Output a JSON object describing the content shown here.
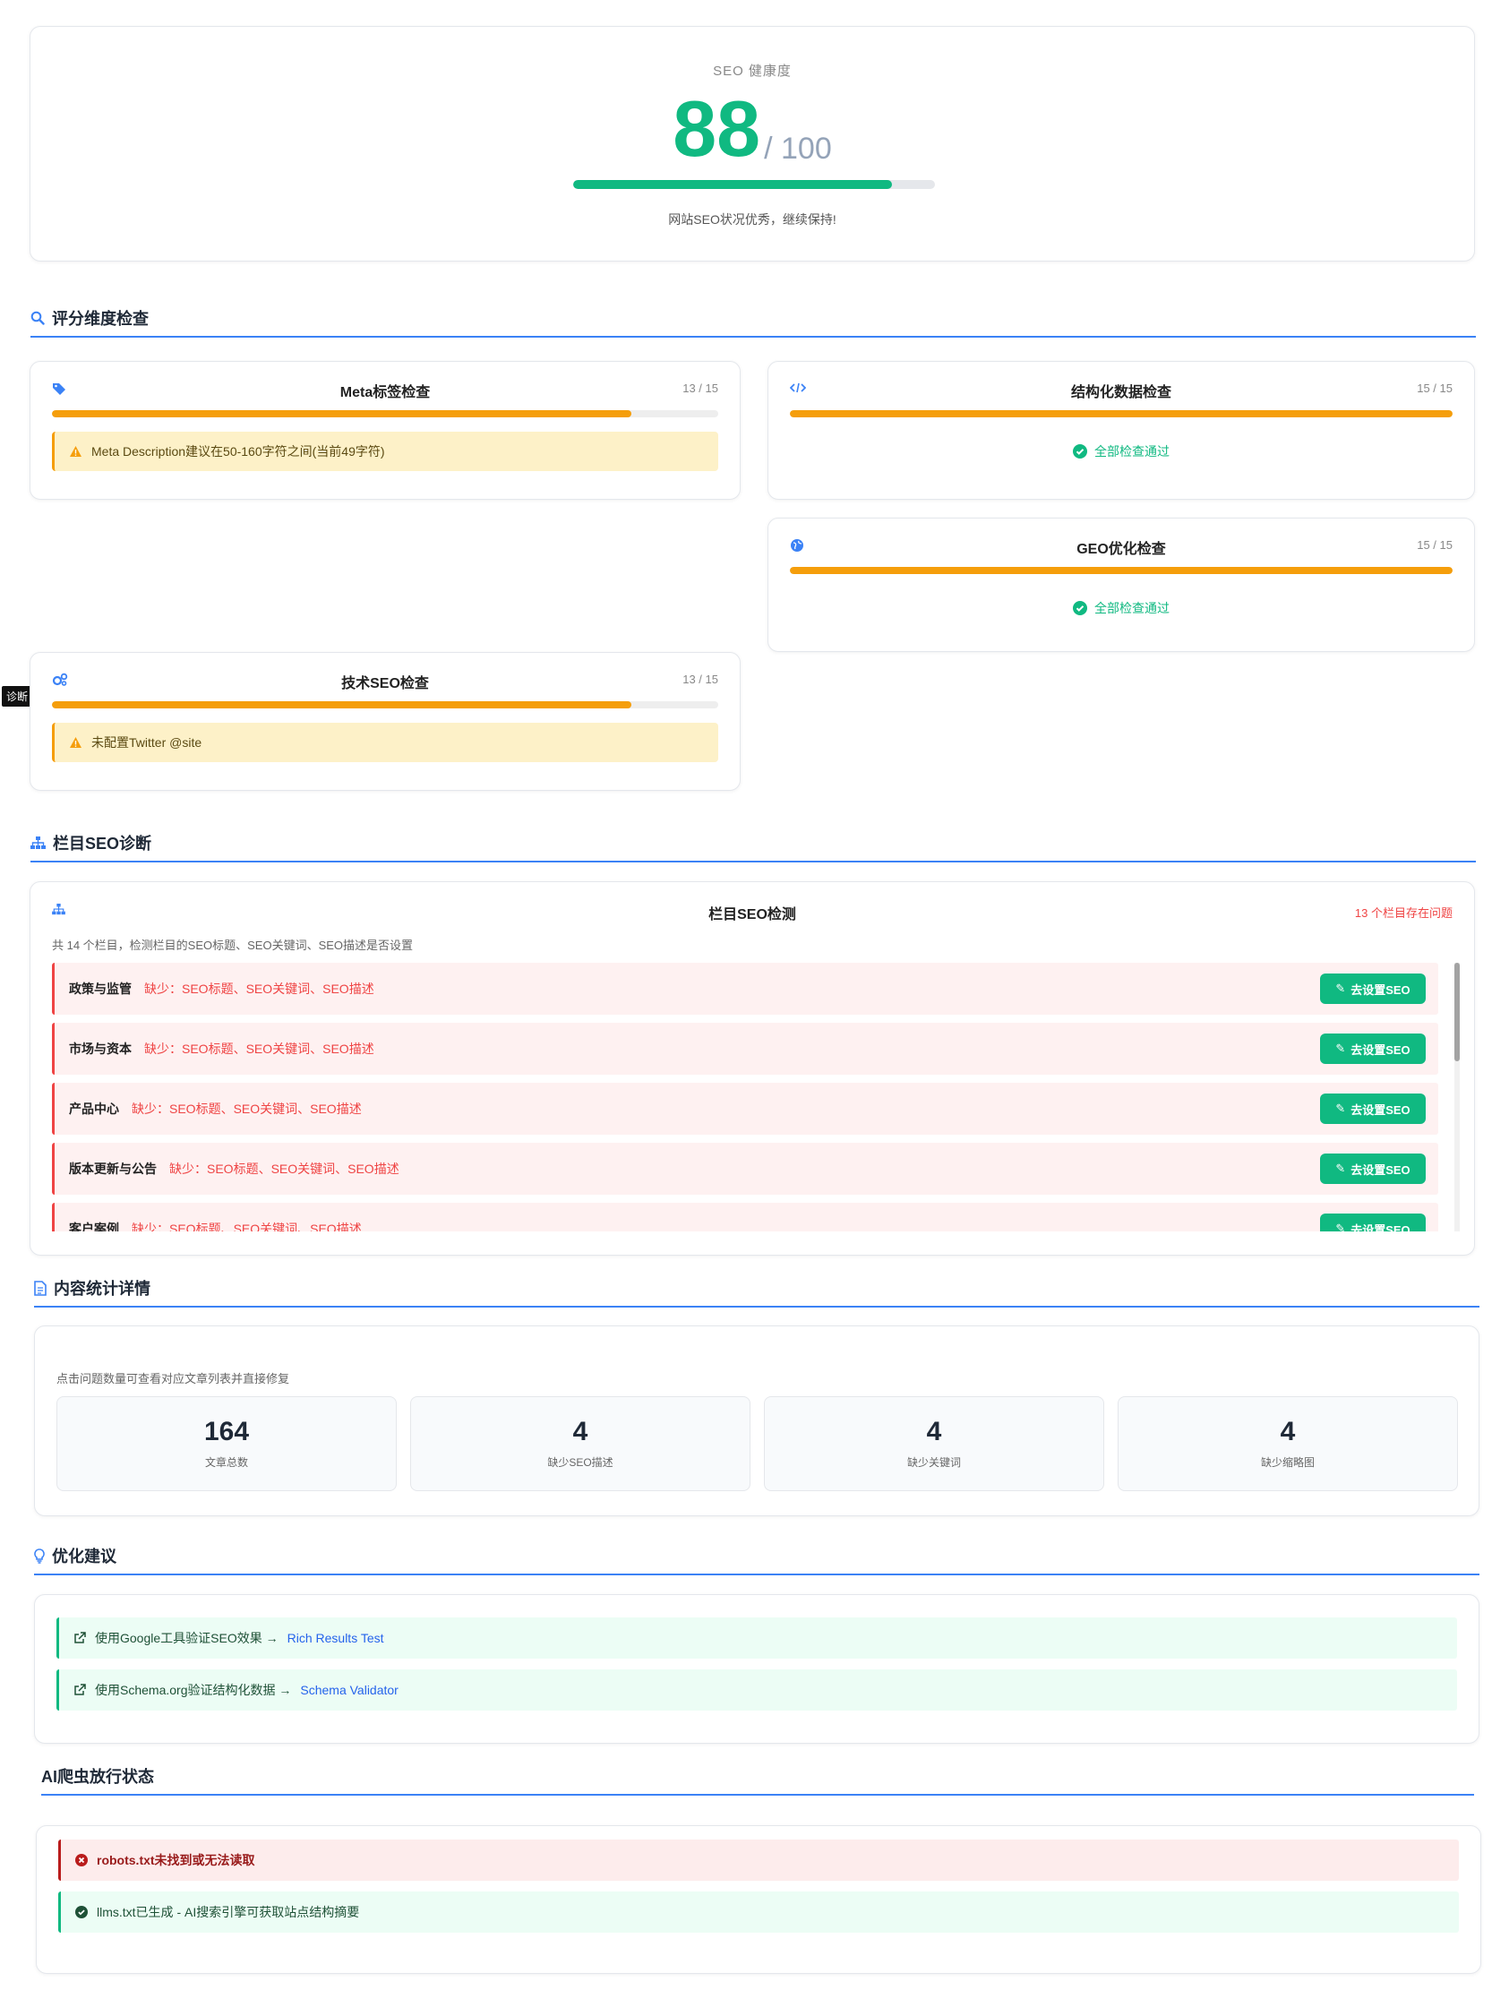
{
  "health": {
    "label": "SEO 健康度",
    "score": "88",
    "max": "/ 100",
    "progress": 0.88,
    "message": "网站SEO状况优秀，继续保持!"
  },
  "dimensions": {
    "title": "评分维度检查",
    "cards": [
      {
        "title": "Meta标签检查",
        "score": "13 / 15",
        "progress": 0.87,
        "warning": "Meta Description建议在50-160字符之间(当前49字符)"
      },
      {
        "title": "结构化数据检查",
        "score": "15 / 15",
        "progress": 1.0,
        "pass": "全部检查通过"
      },
      {
        "title": "GEO优化检查",
        "score": "15 / 15",
        "progress": 1.0,
        "pass": "全部检查通过"
      },
      {
        "title": "技术SEO检查",
        "score": "13 / 15",
        "progress": 0.87,
        "warning": "未配置Twitter @site"
      }
    ]
  },
  "side_tab": "诊断",
  "column_seo": {
    "section_title": "栏目SEO诊断",
    "card_title": "栏目SEO检测",
    "issues": "13 个栏目存在问题",
    "subtitle": "共 14 个栏目，检测栏目的SEO标题、SEO关键词、SEO描述是否设置",
    "button_label": "去设置SEO",
    "rows": [
      {
        "name": "政策与监管",
        "missing": "缺少：SEO标题、SEO关键词、SEO描述"
      },
      {
        "name": "市场与资本",
        "missing": "缺少：SEO标题、SEO关键词、SEO描述"
      },
      {
        "name": "产品中心",
        "missing": "缺少：SEO标题、SEO关键词、SEO描述"
      },
      {
        "name": "版本更新与公告",
        "missing": "缺少：SEO标题、SEO关键词、SEO描述"
      },
      {
        "name": "客户案例",
        "missing": "缺少：SEO标题、SEO关键词、SEO描述"
      }
    ]
  },
  "content_stats": {
    "title": "内容统计详情",
    "hint": "点击问题数量可查看对应文章列表并直接修复",
    "items": [
      {
        "value": "164",
        "label": "文章总数"
      },
      {
        "value": "4",
        "label": "缺少SEO描述"
      },
      {
        "value": "4",
        "label": "缺少关键词"
      },
      {
        "value": "4",
        "label": "缺少缩略图"
      }
    ]
  },
  "suggestions": {
    "title": "优化建议",
    "items": [
      {
        "text": "使用Google工具验证SEO效果 →",
        "link": "Rich Results Test"
      },
      {
        "text": "使用Schema.org验证结构化数据 →",
        "link": "Schema Validator"
      }
    ]
  },
  "ai_crawler": {
    "title": "AI爬虫放行状态",
    "items": [
      {
        "text": "robots.txt未找到或无法读取",
        "status": "error"
      },
      {
        "text": "llms.txt已生成 - AI搜索引擎可获取站点结构摘要",
        "status": "ok"
      }
    ]
  },
  "colors": {
    "green": "#10b981",
    "orange": "#f59e0b",
    "red": "#ef4444",
    "blue": "#3b82f6"
  }
}
